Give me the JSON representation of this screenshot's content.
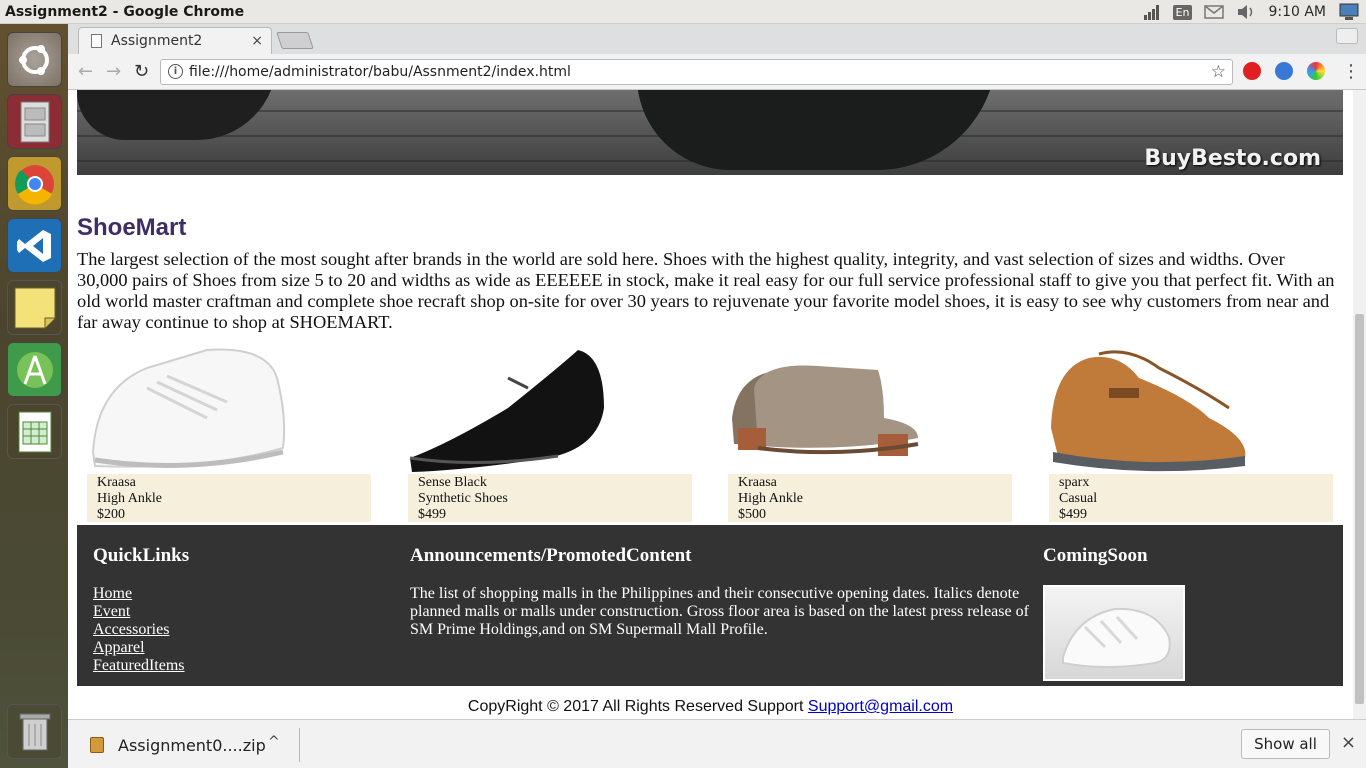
{
  "os": {
    "window_title": "Assignment2 - Google Chrome",
    "lang_indicator": "En",
    "clock": "9:10 AM"
  },
  "browser": {
    "tab_title": "Assignment2",
    "tab_close": "×",
    "url": "file:///home/administrator/babu/Assnment2/index.html",
    "back": "←",
    "forward": "→",
    "reload": "↻",
    "info": "i",
    "star": "☆",
    "menu": "⋮"
  },
  "page": {
    "banner_brand": "BuyBesto.com",
    "title": "ShoeMart",
    "intro": "The largest selection of the most sought after brands in the world are sold here. Shoes with the highest quality, integrity, and vast selection of sizes and widths. Over 30,000 pairs of Shoes from size 5 to 20 and widths as wide as EEEEEE in stock, make it real easy for our full service professional staff to give you that perfect fit. With an old world master craftman and complete shoe recraft shop on-site for over 30 years to rejuvenate your favorite model shoes, it is easy to see why customers from near and far away continue to shop at SHOEMART.",
    "products": [
      {
        "brand": "Kraasa",
        "type": "High Ankle",
        "price": "$200"
      },
      {
        "brand": "Sense Black",
        "type": "Synthetic Shoes",
        "price": "$499"
      },
      {
        "brand": "Kraasa",
        "type": "High Ankle",
        "price": "$500"
      },
      {
        "brand": "sparx",
        "type": "Casual",
        "price": "$499"
      }
    ],
    "footer": {
      "quicklinks_title": "QuickLinks",
      "links": [
        "Home",
        "Event",
        "Accessories",
        "Apparel",
        "FeaturedItems"
      ],
      "announcements_title": "Announcements/PromotedContent",
      "announcements_text": "The list of shopping malls in the Philippines and their consecutive opening dates. Italics denote planned malls or malls under construction. Gross floor area is based on the latest press release of SM Prime Holdings,and on SM Supermall Mall Profile.",
      "coming_soon_title": "ComingSoon"
    },
    "copyright_text": "CopyRight © 2017 All Rights Reserved Support ",
    "support_email": "Support@gmail.com"
  },
  "downloads": {
    "file_name": "Assignment0....zip",
    "chevron": "^",
    "show_all": "Show all",
    "close": "×"
  }
}
